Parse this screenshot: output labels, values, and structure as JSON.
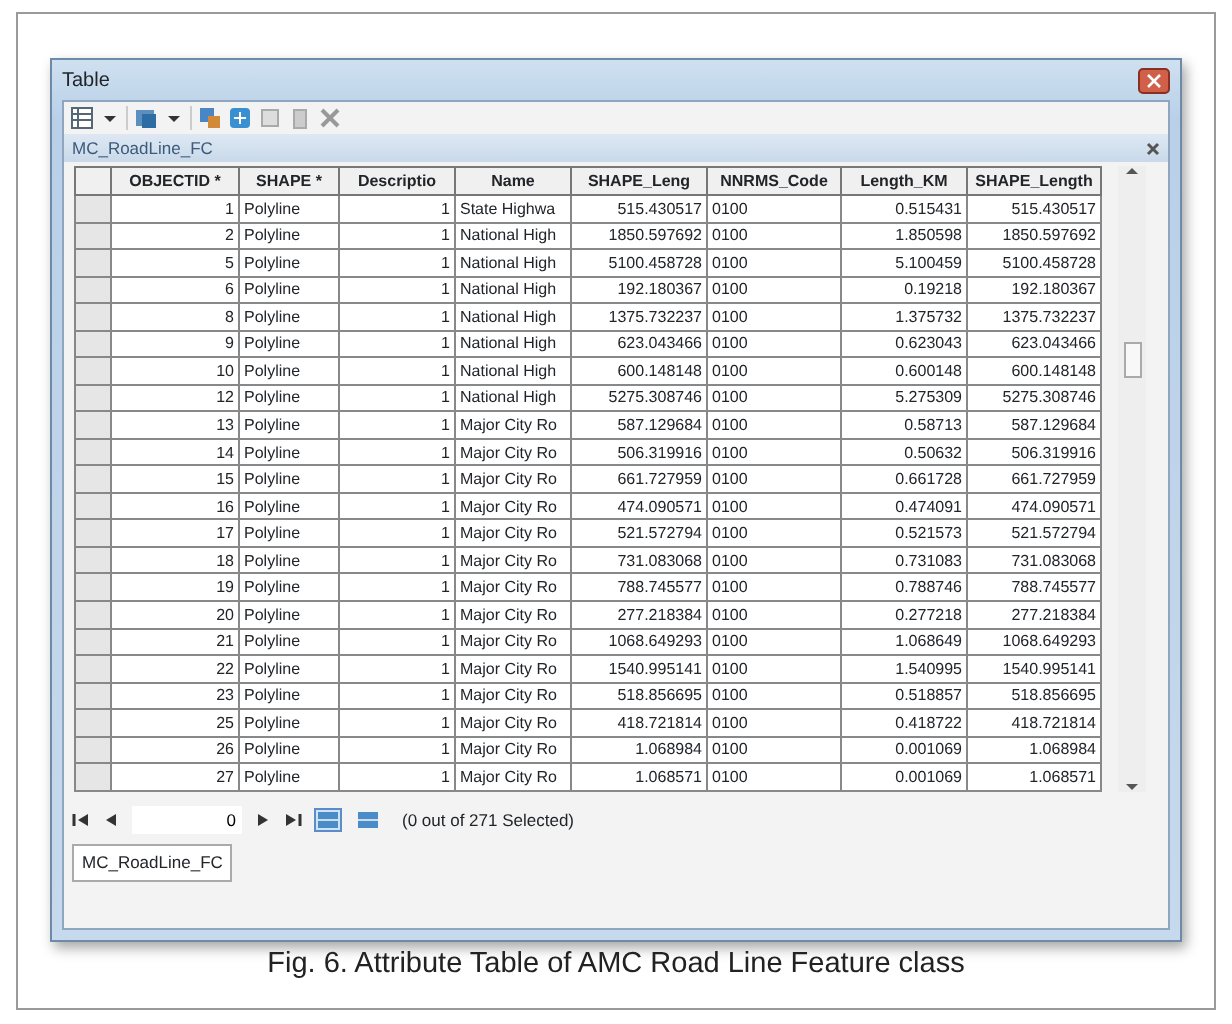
{
  "window": {
    "title": "Table"
  },
  "table_name": "MC_RoadLine_FC",
  "table": {
    "columns": [
      "OBJECTID *",
      "SHAPE *",
      "Descriptio",
      "Name",
      "SHAPE_Leng",
      "NNRMS_Code",
      "Length_KM",
      "SHAPE_Length"
    ],
    "rows": [
      {
        "selected": false,
        "cells": [
          "1",
          "Polyline",
          "1",
          "State Highwa",
          "515.430517",
          "0100",
          "0.515431",
          "515.430517"
        ]
      },
      {
        "selected": false,
        "cells": [
          "2",
          "Polyline",
          "1",
          "National High",
          "1850.597692",
          "0100",
          "1.850598",
          "1850.597692"
        ]
      },
      {
        "selected": false,
        "cells": [
          "5",
          "Polyline",
          "1",
          "National High",
          "5100.458728",
          "0100",
          "5.100459",
          "5100.458728"
        ]
      },
      {
        "selected": false,
        "cells": [
          "6",
          "Polyline",
          "1",
          "National High",
          "192.180367",
          "0100",
          "0.19218",
          "192.180367"
        ]
      },
      {
        "selected": false,
        "cells": [
          "8",
          "Polyline",
          "1",
          "National High",
          "1375.732237",
          "0100",
          "1.375732",
          "1375.732237"
        ]
      },
      {
        "selected": false,
        "cells": [
          "9",
          "Polyline",
          "1",
          "National High",
          "623.043466",
          "0100",
          "0.623043",
          "623.043466"
        ]
      },
      {
        "selected": false,
        "cells": [
          "10",
          "Polyline",
          "1",
          "National High",
          "600.148148",
          "0100",
          "0.600148",
          "600.148148"
        ]
      },
      {
        "selected": false,
        "cells": [
          "12",
          "Polyline",
          "1",
          "National High",
          "5275.308746",
          "0100",
          "5.275309",
          "5275.308746"
        ]
      },
      {
        "selected": false,
        "cells": [
          "13",
          "Polyline",
          "1",
          "Major City Ro",
          "587.129684",
          "0100",
          "0.58713",
          "587.129684"
        ]
      },
      {
        "selected": false,
        "cells": [
          "14",
          "Polyline",
          "1",
          "Major City Ro",
          "506.319916",
          "0100",
          "0.50632",
          "506.319916"
        ]
      },
      {
        "selected": false,
        "cells": [
          "15",
          "Polyline",
          "1",
          "Major City Ro",
          "661.727959",
          "0100",
          "0.661728",
          "661.727959"
        ]
      },
      {
        "selected": false,
        "cells": [
          "16",
          "Polyline",
          "1",
          "Major City Ro",
          "474.090571",
          "0100",
          "0.474091",
          "474.090571"
        ]
      },
      {
        "selected": false,
        "cells": [
          "17",
          "Polyline",
          "1",
          "Major City Ro",
          "521.572794",
          "0100",
          "0.521573",
          "521.572794"
        ]
      },
      {
        "selected": false,
        "cells": [
          "18",
          "Polyline",
          "1",
          "Major City Ro",
          "731.083068",
          "0100",
          "0.731083",
          "731.083068"
        ]
      },
      {
        "selected": false,
        "cells": [
          "19",
          "Polyline",
          "1",
          "Major City Ro",
          "788.745577",
          "0100",
          "0.788746",
          "788.745577"
        ]
      },
      {
        "selected": false,
        "cells": [
          "20",
          "Polyline",
          "1",
          "Major City Ro",
          "277.218384",
          "0100",
          "0.277218",
          "277.218384"
        ]
      },
      {
        "selected": false,
        "cells": [
          "21",
          "Polyline",
          "1",
          "Major City Ro",
          "1068.649293",
          "0100",
          "1.068649",
          "1068.649293"
        ]
      },
      {
        "selected": false,
        "cells": [
          "22",
          "Polyline",
          "1",
          "Major City Ro",
          "1540.995141",
          "0100",
          "1.540995",
          "1540.995141"
        ]
      },
      {
        "selected": false,
        "cells": [
          "23",
          "Polyline",
          "1",
          "Major City Ro",
          "518.856695",
          "0100",
          "0.518857",
          "518.856695"
        ]
      },
      {
        "selected": false,
        "cells": [
          "25",
          "Polyline",
          "1",
          "Major City Ro",
          "418.721814",
          "0100",
          "0.418722",
          "418.721814"
        ]
      },
      {
        "selected": false,
        "cells": [
          "26",
          "Polyline",
          "1",
          "Major City Ro",
          "1.068984",
          "0100",
          "0.001069",
          "1.068984"
        ]
      },
      {
        "selected": false,
        "cells": [
          "27",
          "Polyline",
          "1",
          "Major City Ro",
          "1.068571",
          "0100",
          "0.001069",
          "1.068571"
        ]
      }
    ]
  },
  "navigation": {
    "record": "0",
    "views": [
      {
        "selected": true
      },
      {
        "selected": false
      }
    ],
    "status": "(0 out of 271 Selected)"
  },
  "tabs": [
    {
      "label": "MC_RoadLine_FC",
      "selected": true
    }
  ],
  "caption": "Fig. 6. Attribute Table of AMC Road Line Feature class"
}
